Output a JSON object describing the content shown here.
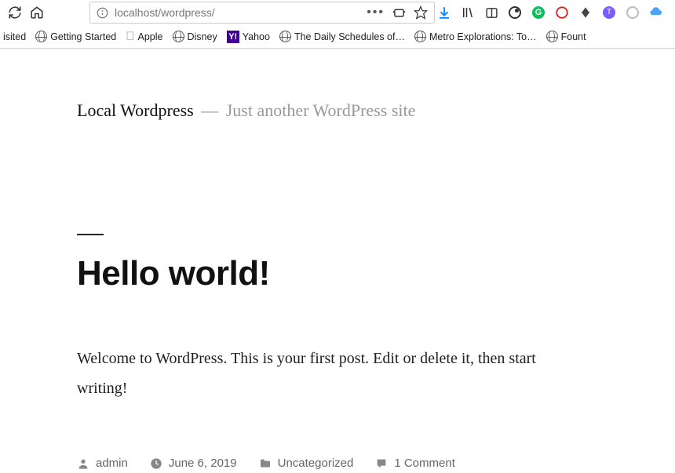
{
  "browser": {
    "url": "localhost/wordpress/"
  },
  "bookmarks": {
    "items": [
      "isited",
      "Getting Started",
      "Apple",
      "Disney",
      "Yahoo",
      "The Daily Schedules of…",
      "Metro Explorations: To…",
      "Fount"
    ]
  },
  "site": {
    "title": "Local Wordpress",
    "tagline_dash": "—",
    "tagline": "Just another WordPress site"
  },
  "post": {
    "title": "Hello world!",
    "body": "Welcome to WordPress. This is your first post. Edit or delete it, then start writing!",
    "meta": {
      "author": "admin",
      "date": "June 6, 2019",
      "category": "Uncategorized",
      "comments": "1 Comment"
    }
  }
}
